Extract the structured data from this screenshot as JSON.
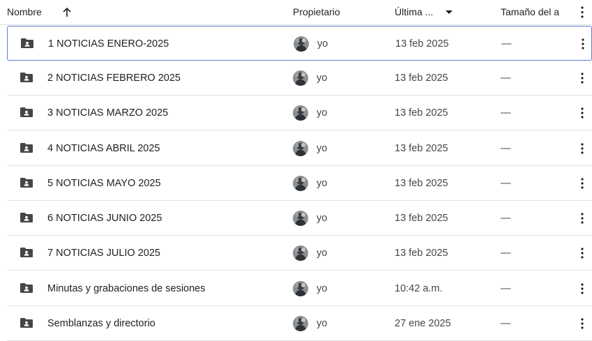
{
  "header": {
    "name_label": "Nombre",
    "owner_label": "Propietario",
    "modified_label": "Última ...",
    "size_label": "Tamaño del a"
  },
  "rows": [
    {
      "name": "1 NOTICIAS ENERO-2025",
      "owner": "yo",
      "modified": "13 feb 2025",
      "size": "—"
    },
    {
      "name": "2 NOTICIAS FEBRERO 2025",
      "owner": "yo",
      "modified": "13 feb 2025",
      "size": "—"
    },
    {
      "name": "3 NOTICIAS MARZO 2025",
      "owner": "yo",
      "modified": "13 feb 2025",
      "size": "—"
    },
    {
      "name": "4 NOTICIAS ABRIL 2025",
      "owner": "yo",
      "modified": "13 feb 2025",
      "size": "—"
    },
    {
      "name": "5 NOTICIAS MAYO 2025",
      "owner": "yo",
      "modified": "13 feb 2025",
      "size": "—"
    },
    {
      "name": "6 NOTICIAS JUNIO 2025",
      "owner": "yo",
      "modified": "13 feb 2025",
      "size": "—"
    },
    {
      "name": "7 NOTICIAS JULIO 2025",
      "owner": "yo",
      "modified": "13 feb 2025",
      "size": "—"
    },
    {
      "name": "Minutas y grabaciones de sesiones",
      "owner": "yo",
      "modified": "10:42 a.m.",
      "size": "—"
    },
    {
      "name": "Semblanzas y directorio",
      "owner": "yo",
      "modified": "27 ene 2025",
      "size": "—"
    }
  ],
  "icons": {
    "sort": "arrow-up-icon",
    "sort_menu": "caret-down-icon",
    "folder": "shared-folder-icon",
    "more": "more-vertical-icon"
  },
  "colors": {
    "selected_border": "#5b7fd6",
    "folder": "#444746",
    "divider": "#e0e0e0"
  }
}
